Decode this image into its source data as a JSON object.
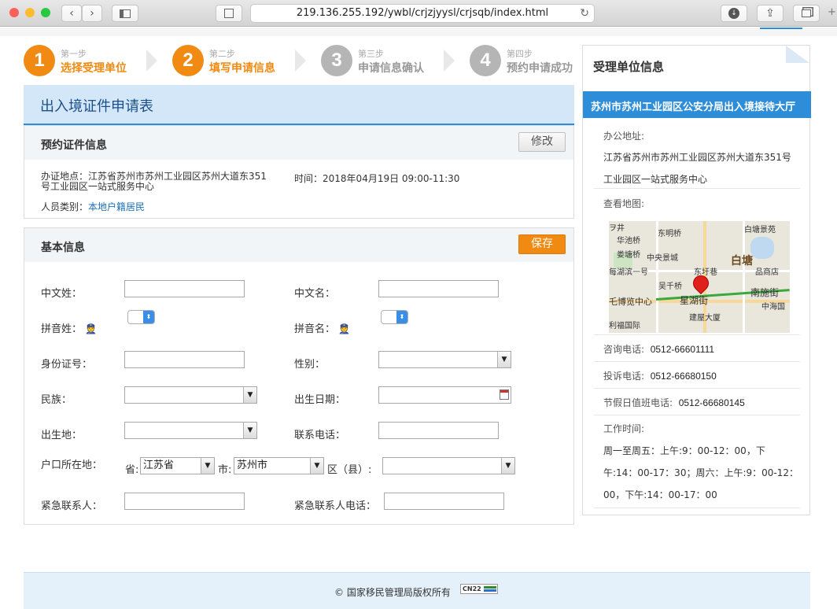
{
  "browser": {
    "url": "219.136.255.192/ywbl/crjzjyysl/crjsqb/index.html"
  },
  "steps": [
    {
      "num": "1",
      "small": "第一步",
      "label": "选择受理单位"
    },
    {
      "num": "2",
      "small": "第二步",
      "label": "填写申请信息"
    },
    {
      "num": "3",
      "small": "第三步",
      "label": "申请信息确认"
    },
    {
      "num": "4",
      "small": "第四步",
      "label": "预约申请成功"
    }
  ],
  "form_title": "出入境证件申请表",
  "appointment": {
    "title": "预约证件信息",
    "edit_label": "修改",
    "location_label": "办证地点：",
    "location_line1": "江苏省苏州市苏州工业园区苏州大道东351",
    "location_line2": "号工业园区一站式服务中心",
    "time_label": "时间：",
    "time_value": "2018年04月19日 09:00-11:30",
    "category_label": "人员类别：",
    "category_value": "本地户籍居民"
  },
  "basic": {
    "title": "基本信息",
    "save_label": "保存",
    "surname": "中文姓：",
    "given_name": "中文名：",
    "pinyin_surname": "拼音姓：",
    "pinyin_given": "拼音名：",
    "id_number": "身份证号：",
    "gender": "性别：",
    "ethnicity": "民族：",
    "birthdate": "出生日期：",
    "birthplace": "出生地：",
    "phone": "联系电话：",
    "hukou": "户口所在地：",
    "province_label": "省:",
    "province_value": "江苏省",
    "city_label": "市:",
    "city_value": "苏州市",
    "district_label": "区（县）:",
    "emergency_contact": "紧急联系人：",
    "emergency_phone": "紧急联系人电话："
  },
  "sidebar": {
    "title": "受理单位信息",
    "office_name": "苏州市苏州工业园区公安分局出入境接待大厅",
    "address_label": "办公地址:",
    "address_line1": "江苏省苏州市苏州工业园区苏州大道东351号",
    "address_line2": "工业园区一站式服务中心",
    "map_label": "查看地图:",
    "consult_label": "咨询电话:",
    "consult_value": "0512-66601111",
    "complaint_label": "投诉电话:",
    "complaint_value": "0512-66680150",
    "holiday_label": "节假日值班电话:",
    "holiday_value": "0512-66680145",
    "hours_label": "工作时间:",
    "hours_line1": "周一至周五：上午:9：00-12：00，下",
    "hours_line2": "午:14：00-17：30；周六：上午:9：00-12：",
    "hours_line3": "00，下午:14：00-17：00"
  },
  "map": {
    "labels": [
      "东明桥",
      "华池桥",
      "娄塘桥",
      "中央景城",
      "东圩巷",
      "每湖滨一号",
      "吴千桥",
      "白塘",
      "白塘景苑",
      "品商店",
      "南施街",
      "星湖街",
      "中海国",
      "乇博览中心",
      "建屋大厦",
      "利福国际",
      "ヲ井"
    ]
  },
  "footer": {
    "copyright": "© 国家移民管理局版权所有",
    "badge": "CN22"
  },
  "colors": {
    "accent_orange": "#f08a12",
    "accent_blue": "#2e8dd8",
    "header_light_blue": "#d3e7f8"
  }
}
